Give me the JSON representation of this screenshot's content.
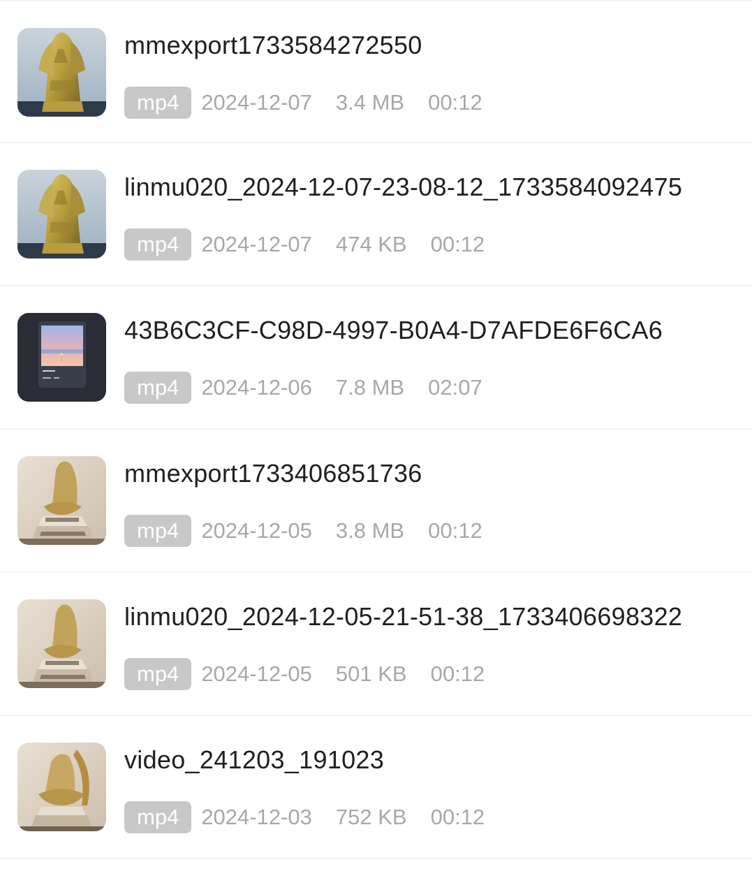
{
  "files": [
    {
      "name": "mmexport1733584272550",
      "type": "mp4",
      "date": "2024-12-07",
      "size": "3.4 MB",
      "duration": "00:12",
      "thumbnail": "statue-gold"
    },
    {
      "name": "linmu020_2024-12-07-23-08-12_1733584092475",
      "type": "mp4",
      "date": "2024-12-07",
      "size": "474 KB",
      "duration": "00:12",
      "thumbnail": "statue-gold"
    },
    {
      "name": "43B6C3CF-C98D-4997-B0A4-D7AFDE6F6CA6",
      "type": "mp4",
      "date": "2024-12-06",
      "size": "7.8 MB",
      "duration": "02:07",
      "thumbnail": "dark-screen"
    },
    {
      "name": "mmexport1733406851736",
      "type": "mp4",
      "date": "2024-12-05",
      "size": "3.8 MB",
      "duration": "00:12",
      "thumbnail": "statue-lotus"
    },
    {
      "name": "linmu020_2024-12-05-21-51-38_1733406698322",
      "type": "mp4",
      "date": "2024-12-05",
      "size": "501 KB",
      "duration": "00:12",
      "thumbnail": "statue-lotus"
    },
    {
      "name": "video_241203_191023",
      "type": "mp4",
      "date": "2024-12-03",
      "size": "752 KB",
      "duration": "00:12",
      "thumbnail": "statue-lotus"
    }
  ],
  "colors": {
    "badge_bg": "#c8c8c8",
    "meta_text": "#a8a8a8",
    "name_text": "#1f1f1f",
    "divider": "#f3f3f3"
  }
}
